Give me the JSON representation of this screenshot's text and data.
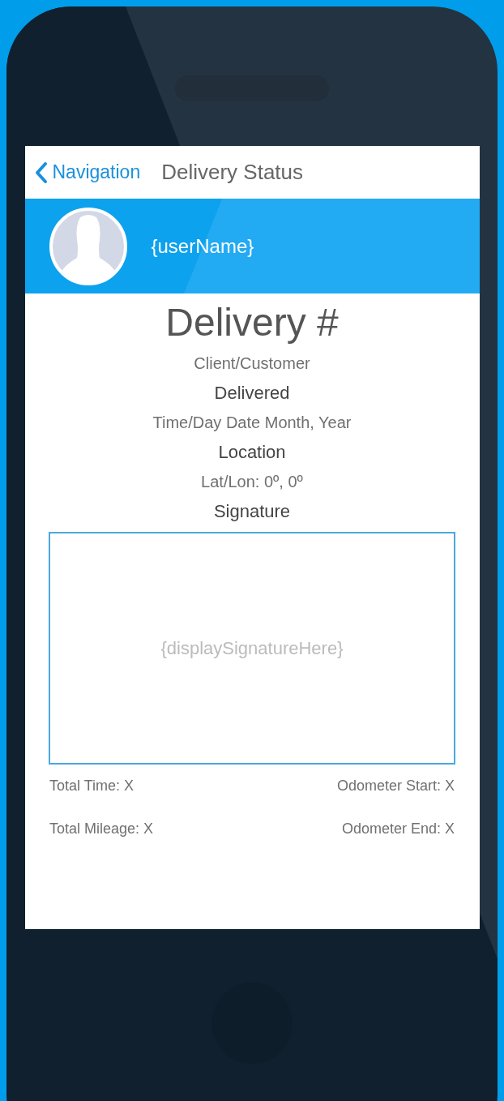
{
  "nav": {
    "back_label": "Navigation",
    "title": "Delivery Status"
  },
  "profile": {
    "user_name": "{userName}"
  },
  "delivery": {
    "title": "Delivery #",
    "client": "Client/Customer",
    "sections": [
      {
        "heading": "Delivered",
        "value": "Time/Day Date Month, Year"
      },
      {
        "heading": "Location",
        "value": "Lat/Lon: 0º, 0º"
      }
    ],
    "signature": {
      "heading": "Signature",
      "text": "{displaySignatureHere}"
    }
  },
  "stats": [
    {
      "left": "Total Time: X",
      "right": "Odometer Start: X"
    },
    {
      "left": "Total Mileage: X",
      "right": "Odometer End: X"
    }
  ]
}
